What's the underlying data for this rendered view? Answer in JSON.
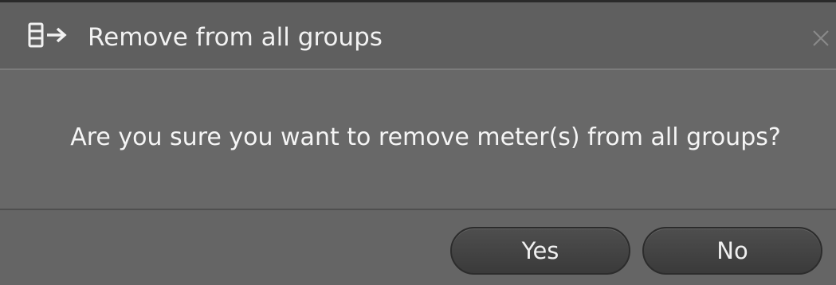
{
  "dialog": {
    "title": "Remove from all groups",
    "title_icon": "remove-from-group-icon",
    "close_icon": "close-icon",
    "message": "Are you sure you want to remove meter(s) from all groups?",
    "buttons": {
      "yes_label": "Yes",
      "no_label": "No"
    }
  },
  "colors": {
    "title_bg": "#5f5f5f",
    "body_bg": "#686868",
    "button_bg": "#3f3f3f",
    "text": "#f2f2f2"
  }
}
